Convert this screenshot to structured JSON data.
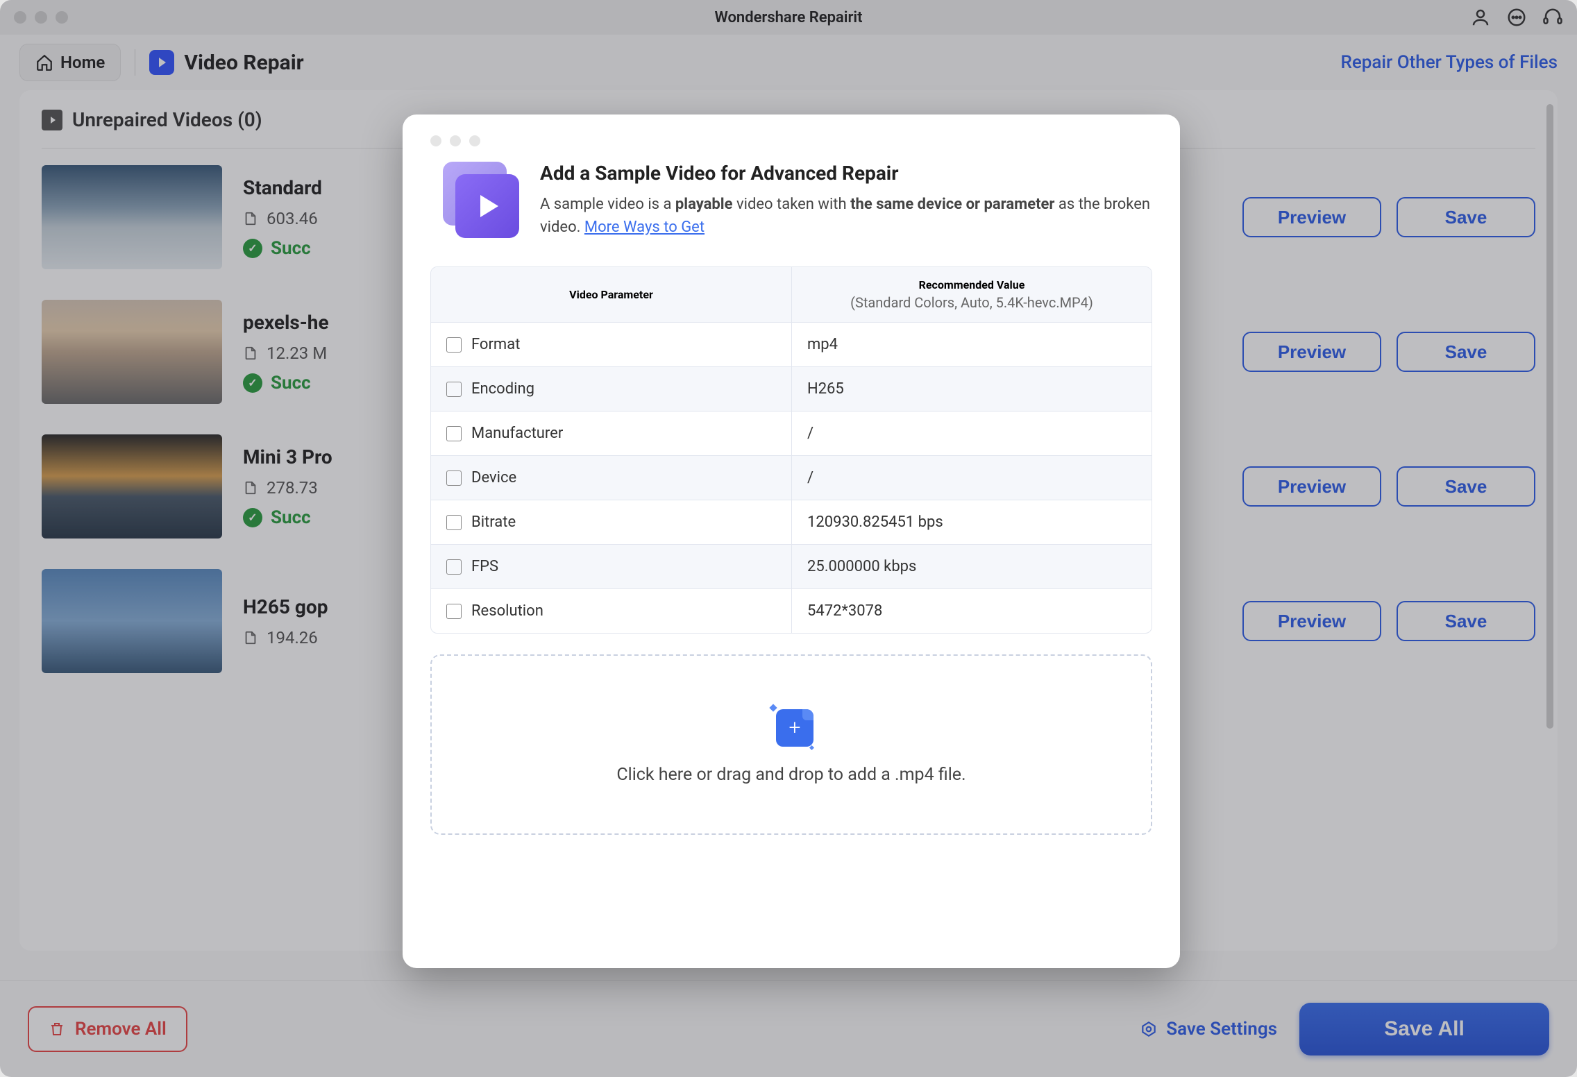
{
  "titlebar": {
    "title": "Wondershare Repairit"
  },
  "toolbar": {
    "home": "Home",
    "page_title": "Video Repair",
    "repair_other": "Repair Other Types of Files"
  },
  "panel": {
    "header": "Unrepaired Videos (0)",
    "preview_label": "Preview",
    "save_label": "Save",
    "success_label": "Succ",
    "items": [
      {
        "name": "Standard",
        "size": "603.46"
      },
      {
        "name": "pexels-he",
        "size": "12.23 M"
      },
      {
        "name": "Mini 3 Pro",
        "size": "278.73"
      },
      {
        "name": "H265 gop",
        "size": "194.26"
      }
    ]
  },
  "footer": {
    "remove_all": "Remove All",
    "save_settings": "Save Settings",
    "save_all": "Save All"
  },
  "modal": {
    "title": "Add a Sample Video for Advanced Repair",
    "desc_pre": "A sample video is a ",
    "desc_b1": "playable",
    "desc_mid": " video taken with ",
    "desc_b2": "the same device or parameter",
    "desc_post": " as the broken video. ",
    "more_ways": "More Ways to Get",
    "col1": "Video Parameter",
    "col2": "Recommended Value",
    "col2_sub": "(Standard Colors, Auto, 5.4K-hevc.MP4)",
    "rows": [
      {
        "label": "Format",
        "value": "mp4"
      },
      {
        "label": "Encoding",
        "value": "H265"
      },
      {
        "label": "Manufacturer",
        "value": "/"
      },
      {
        "label": "Device",
        "value": "/"
      },
      {
        "label": "Bitrate",
        "value": "120930.825451 bps"
      },
      {
        "label": "FPS",
        "value": "25.000000 kbps"
      },
      {
        "label": "Resolution",
        "value": "5472*3078"
      }
    ],
    "dropzone_text": "Click here or drag and drop to add a .mp4 file."
  }
}
